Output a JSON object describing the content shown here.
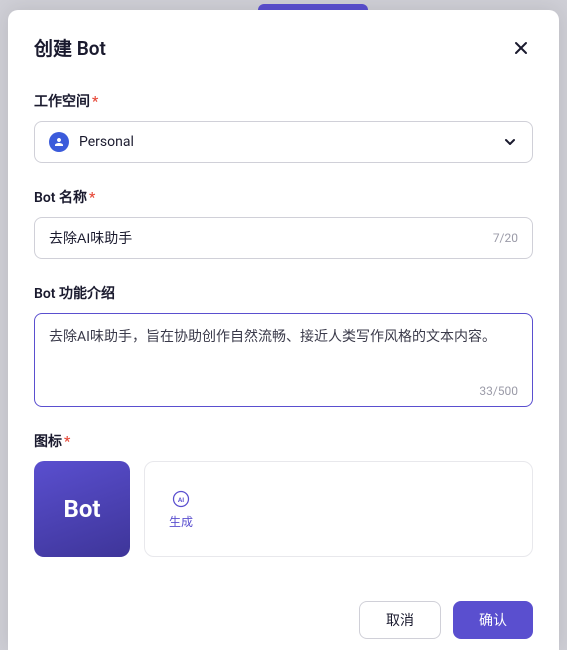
{
  "modal": {
    "title": "创建 Bot"
  },
  "workspace": {
    "label": "工作空间",
    "value": "Personal"
  },
  "botName": {
    "label": "Bot 名称",
    "value": "去除AI味助手",
    "counter": "7/20"
  },
  "botDesc": {
    "label": "Bot 功能介绍",
    "value": "去除AI味助手，旨在协助创作自然流畅、接近人类写作风格的文本内容。",
    "counter": "33/500"
  },
  "icon": {
    "label": "图标",
    "previewText": "Bot",
    "generateLabel": "生成"
  },
  "footer": {
    "cancel": "取消",
    "confirm": "确认"
  }
}
